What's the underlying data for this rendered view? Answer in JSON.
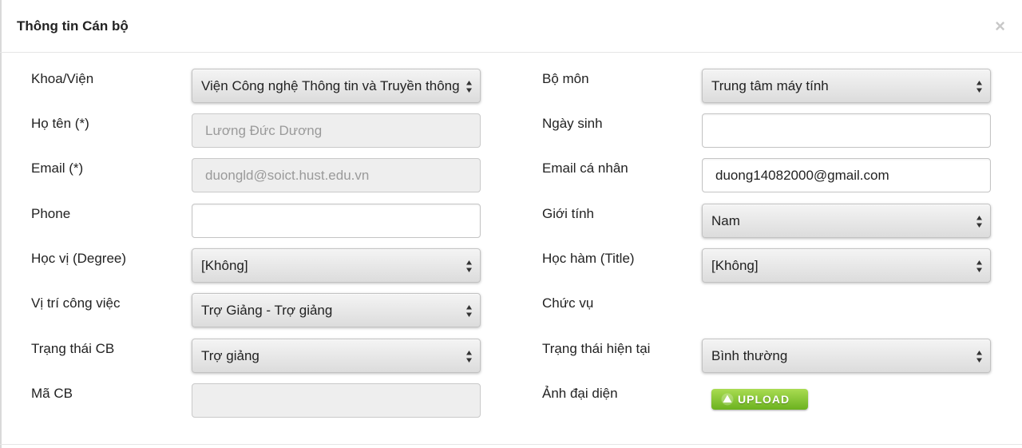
{
  "modal": {
    "title": "Thông tin Cán bộ",
    "close_label": "×"
  },
  "left": {
    "faculty": {
      "label": "Khoa/Viện",
      "value": "Viện Công nghệ Thông tin và Truyền thông"
    },
    "full_name": {
      "label": "Họ tên (*)",
      "placeholder": "Lương Đức Dương"
    },
    "email": {
      "label": "Email (*)",
      "placeholder": "duongld@soict.hust.edu.vn"
    },
    "phone": {
      "label": "Phone",
      "value": ""
    },
    "degree": {
      "label": "Học vị (Degree)",
      "value": "[Không]"
    },
    "job_position": {
      "label": "Vị trí công việc",
      "value": "Trợ Giảng - Trợ giảng"
    },
    "staff_status": {
      "label": "Trạng thái CB",
      "value": "Trợ giảng"
    },
    "staff_code": {
      "label": "Mã CB",
      "value": ""
    }
  },
  "right": {
    "department": {
      "label": "Bộ môn",
      "value": "Trung tâm máy tính"
    },
    "birthday": {
      "label": "Ngày sinh",
      "value": ""
    },
    "personal_email": {
      "label": "Email cá nhân",
      "value": "duong14082000@gmail.com"
    },
    "gender": {
      "label": "Giới tính",
      "value": "Nam"
    },
    "title": {
      "label": "Học hàm (Title)",
      "value": "[Không]"
    },
    "position": {
      "label": "Chức vụ"
    },
    "current_status": {
      "label": "Trạng thái hiện tại",
      "value": "Bình thường"
    },
    "avatar": {
      "label": "Ảnh đại diện",
      "upload_label": "UPLOAD"
    }
  },
  "icons": {
    "close": "close-icon",
    "select_arrows": "chevron-updown-icon",
    "upload": "upload-arrow-icon"
  },
  "colors": {
    "upload_green": "#7cc22c",
    "disabled_bg": "#eeeeee",
    "placeholder_text": "#9a9a9a"
  }
}
